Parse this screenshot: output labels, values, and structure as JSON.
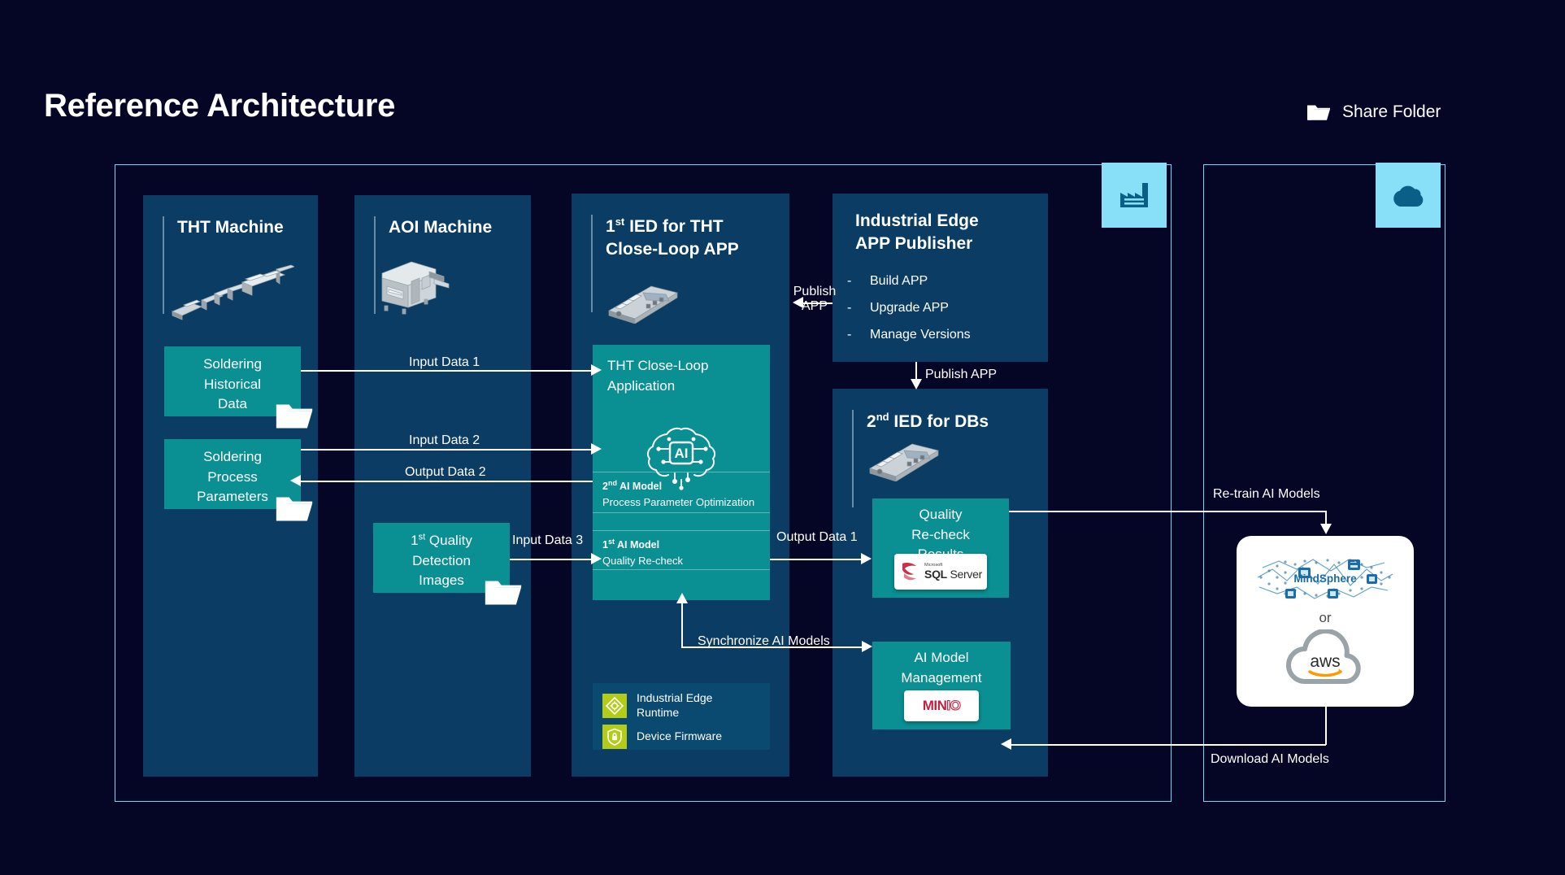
{
  "page": {
    "title": "Reference Architecture",
    "background_color": "#050526"
  },
  "legend": {
    "share_folder_label": "Share Folder",
    "icon": "folder-icon"
  },
  "containers": {
    "factory": {
      "badge_icon": "factory-icon",
      "border_color": "#6fd8f5"
    },
    "cloud": {
      "badge_icon": "cloud-icon",
      "border_color": "#6fd8f5"
    }
  },
  "panels": {
    "tht_machine": {
      "title": "THT Machine",
      "icon": "tht-machine-photo"
    },
    "aoi_machine": {
      "title": "AOI Machine",
      "icon": "aoi-machine-photo"
    },
    "ied1": {
      "title_line1_pre": "1",
      "title_line1_sup": "st",
      "title_line1_post": " IED for THT",
      "title_line2": "Close-Loop APP",
      "icon": "ied-device-photo"
    },
    "publisher": {
      "title_line1": "Industrial Edge",
      "title_line2": "APP Publisher",
      "bullets": [
        "Build APP",
        "Upgrade APP",
        "Manage Versions"
      ],
      "bullet_marker": "-"
    },
    "ied2": {
      "title_pre": "2",
      "title_sup": "nd",
      "title_post": " IED for DBs",
      "icon": "ied-device-photo"
    }
  },
  "data_boxes": {
    "soldering_historical": {
      "lines": [
        "Soldering",
        "Historical",
        "Data"
      ],
      "folder": "folder-icon",
      "color": "#0a8f93"
    },
    "soldering_parameters": {
      "lines": [
        "Soldering",
        "Process",
        "Parameters"
      ],
      "folder": "folder-icon",
      "color": "#0a8f93"
    },
    "quality_images": {
      "line1_pre": "1",
      "line1_sup": "st",
      "line1_post": " Quality",
      "lines": [
        "Detection",
        "Images"
      ],
      "folder": "folder-icon",
      "color": "#0a8f93"
    }
  },
  "app_block": {
    "title_line1": "THT Close-Loop",
    "title_line2": "Application",
    "icon": "ai-brain-icon",
    "models": [
      {
        "name_pre": "2",
        "name_sup": "nd",
        "name_post": " AI Model",
        "subtitle": "Process Parameter Optimization"
      },
      {
        "name_pre": "1",
        "name_sup": "st",
        "name_post": " AI Model",
        "subtitle": "Quality Re-check"
      }
    ]
  },
  "runtime_box": {
    "rows": [
      {
        "label_line1": "Industrial Edge",
        "label_line2": "Runtime",
        "icon": "edge-runtime-icon"
      },
      {
        "label_line1": "Device Firmware",
        "label_line2": "",
        "icon": "shield-lock-icon"
      }
    ],
    "icon_color": "#b4cb17"
  },
  "db_boxes": {
    "quality_results": {
      "lines": [
        "Quality",
        "Re-check",
        "Results"
      ],
      "logo": "sql-server-logo",
      "logo_text_small": "Microsoft",
      "logo_text": "SQL Server"
    },
    "model_management": {
      "lines": [
        "AI Model",
        "Management"
      ],
      "logo": "minio-logo",
      "logo_text_bold": "MIN",
      "logo_text_light": "IO"
    }
  },
  "cloud_card": {
    "mindsphere_label": "MindSphere",
    "or_label": "or",
    "aws_label": "aws",
    "icons": [
      "mindsphere-logo",
      "aws-logo"
    ]
  },
  "flows": [
    {
      "id": "input-data-1",
      "label": "Input Data 1"
    },
    {
      "id": "input-data-2",
      "label": "Input Data 2"
    },
    {
      "id": "output-data-2",
      "label": "Output Data 2"
    },
    {
      "id": "input-data-3",
      "label": "Input Data 3"
    },
    {
      "id": "output-data-1",
      "label": "Output Data 1"
    },
    {
      "id": "publish-app-left",
      "label_line1": "Publish",
      "label_line2": "APP"
    },
    {
      "id": "publish-app-down",
      "label": "Publish APP"
    },
    {
      "id": "synchronize-models",
      "label": "Synchronize AI Models"
    },
    {
      "id": "retrain-models",
      "label": "Re-train AI Models"
    },
    {
      "id": "download-models",
      "label": "Download AI Models"
    }
  ]
}
